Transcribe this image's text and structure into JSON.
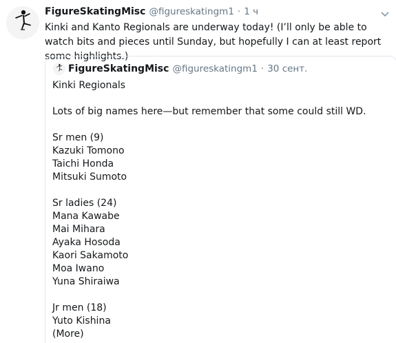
{
  "tweet": {
    "author_name": "FigureSkatingMisc",
    "author_handle": "@figureskatingm1",
    "separator": "·",
    "time": "1 ч",
    "text": "Kinki and Kanto Regionals are underway today! (I’ll only be able to watch bits and pieces until Sunday, but hopefully I can at least report some highlights.)"
  },
  "quote": {
    "author_name": "FigureSkatingMisc",
    "author_handle": "@figureskatingm1",
    "separator": "·",
    "time": "30 сент.",
    "lines": {
      "title": "Kinki Regionals",
      "intro": "Lots of big names here—but remember that some could still WD.",
      "sr_men_header": "Sr men (9)",
      "sr_men_1": "Kazuki Tomono",
      "sr_men_2": "Taichi Honda",
      "sr_men_3": "Mitsuki Sumoto",
      "sr_ladies_header": "Sr ladies (24)",
      "sr_ladies_1": "Mana Kawabe",
      "sr_ladies_2": "Mai Mihara",
      "sr_ladies_3": "Ayaka Hosoda",
      "sr_ladies_4": "Kaori Sakamoto",
      "sr_ladies_5": "Moa Iwano",
      "sr_ladies_6": "Yuna Shiraiwa",
      "jr_men_header": "Jr men (18)",
      "jr_men_1": "Yuto Kishina",
      "more": "(More)"
    }
  },
  "icons": {
    "avatar": "figure-skater-silhouette",
    "caret": "chevron-down-icon"
  },
  "colors": {
    "text": "#14171a",
    "secondary": "#657786",
    "border": "#e1e8ed"
  }
}
